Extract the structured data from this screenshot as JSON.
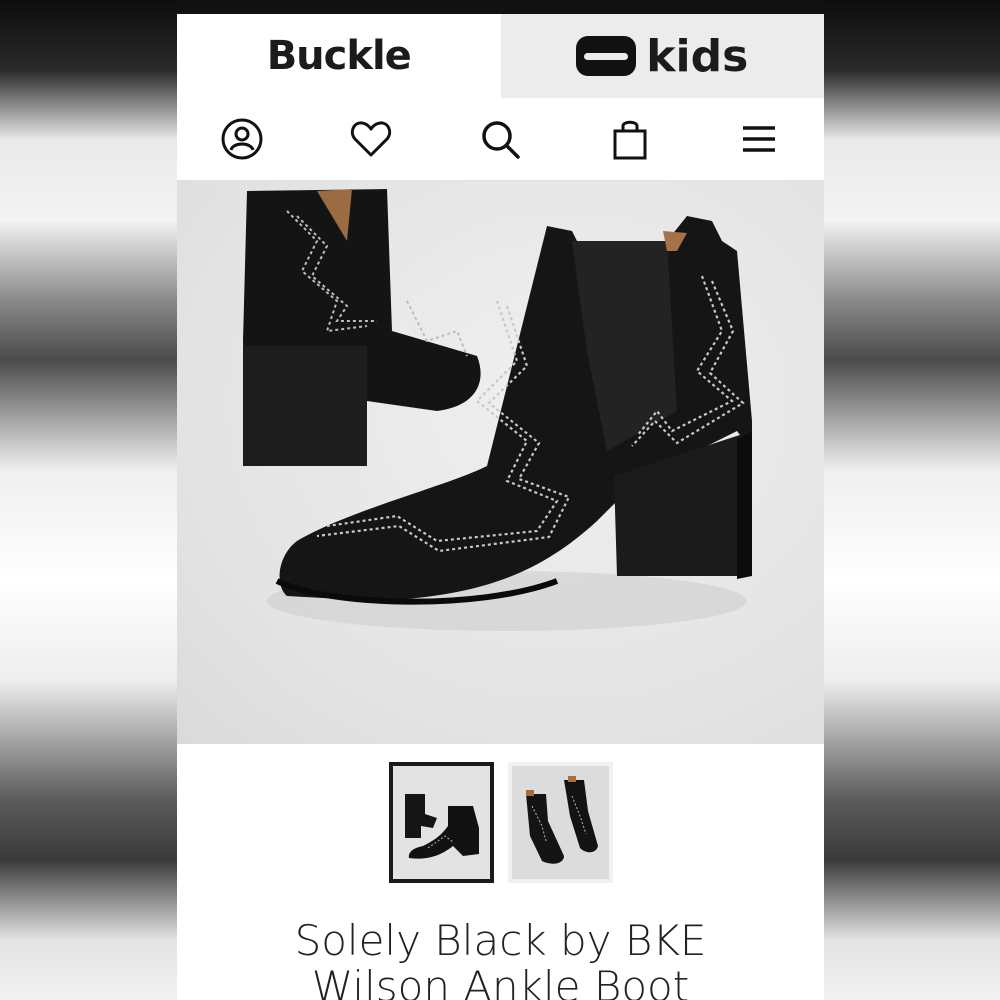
{
  "brand_tabs": {
    "buckle": "Buckle",
    "kids": "kids"
  },
  "icons": [
    "account-icon",
    "heart-icon",
    "search-icon",
    "bag-icon",
    "menu-icon"
  ],
  "hero_image": {
    "alt": "Solely Black by BKE Wilson Ankle Boot"
  },
  "thumbnails": [
    {
      "name": "thumbnail-1",
      "selected": true
    },
    {
      "name": "thumbnail-2",
      "selected": false
    }
  ],
  "product": {
    "title_line1": "Solely Black by BKE",
    "title_line2": "Wilson Ankle Boot"
  },
  "colors": {
    "accent": "#1b1b1b",
    "kids_tab_bg": "#ececec",
    "status_bar": "#111111"
  }
}
